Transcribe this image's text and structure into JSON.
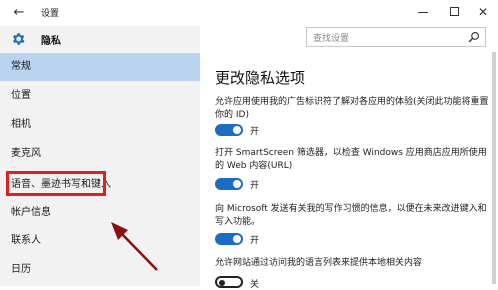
{
  "window": {
    "title": "设置",
    "back_icon": "back-arrow-icon",
    "minimize_icon": "minimize-icon",
    "maximize_icon": "maximize-icon",
    "close_icon": "close-icon",
    "close_glyph": "✕"
  },
  "sidebar": {
    "header_icon": "gear-icon",
    "title": "隐私",
    "items": [
      {
        "label": "常规",
        "active": true
      },
      {
        "label": "位置",
        "active": false
      },
      {
        "label": "相机",
        "active": false
      },
      {
        "label": "麦克风",
        "active": false
      },
      {
        "label": "语音、墨迹书写和键入",
        "active": false
      },
      {
        "label": "帐户信息",
        "active": false
      },
      {
        "label": "联系人",
        "active": false
      },
      {
        "label": "日历",
        "active": false
      }
    ]
  },
  "search": {
    "placeholder": "查找设置",
    "icon": "search-icon"
  },
  "content": {
    "heading": "更改隐私选项",
    "settings": [
      {
        "description": "允许应用使用我的广告标识符了解对各应用的体验(关闭此功能将重置你的 ID)",
        "state": "on",
        "state_label": "开"
      },
      {
        "description": "打开 SmartScreen 筛选器，以检查 Windows 应用商店应用所使用的 Web 内容(URL)",
        "state": "on",
        "state_label": "开"
      },
      {
        "description": "向 Microsoft 发送有关我的写作习惯的信息，以便在未来改进键入和写入功能。",
        "state": "on",
        "state_label": "开"
      },
      {
        "description": "允许网站通过访问我的语言列表来提供本地相关内容",
        "state": "off",
        "state_label": "关"
      }
    ]
  },
  "annotation": {
    "highlight_color": "#e02020",
    "arrow_color": "#8b1010"
  },
  "colors": {
    "accent": "#1d6cc4",
    "sidebar_bg": "#f2f2f2",
    "active_item_bg": "#b9d3f0"
  }
}
